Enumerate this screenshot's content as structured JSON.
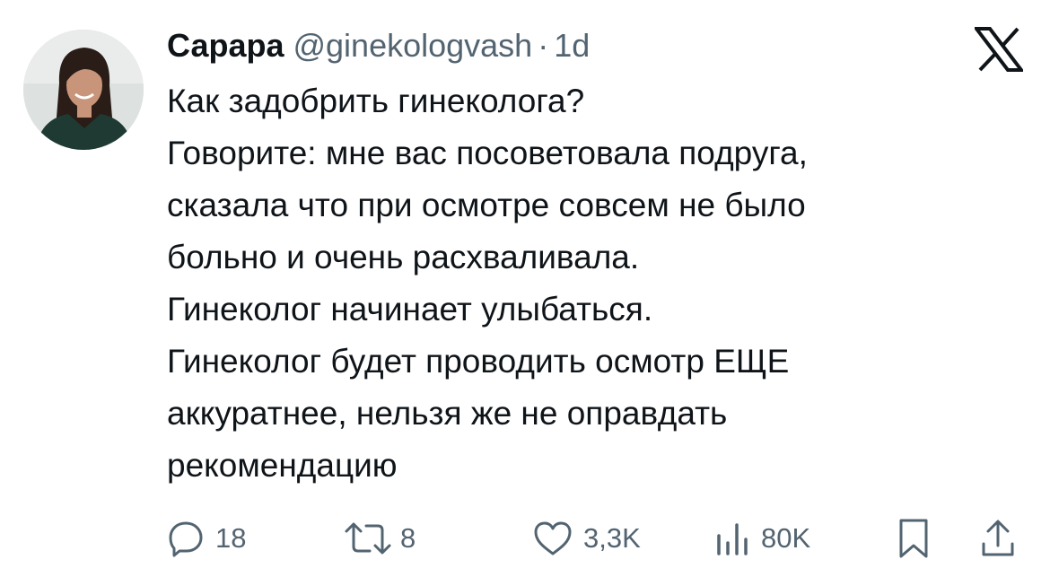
{
  "colors": {
    "text_primary": "#0f1419",
    "text_secondary": "#536471",
    "background": "#ffffff"
  },
  "author": {
    "display_name": "Сарара",
    "handle": "@ginekologvash",
    "separator": "·",
    "time": "1d",
    "avatar_icon": "profile-photo-woman"
  },
  "brand_icon": "x-logo-icon",
  "tweet": {
    "lines": [
      "Как задобрить гинеколога?",
      "Говорите: мне вас посоветовала подруга,",
      "сказала что при осмотре совсем не было",
      "больно и очень расхваливала.",
      "Гинеколог начинает улыбаться.",
      "Гинеколог будет проводить осмотр ЕЩЕ",
      "аккуратнее, нельзя же не оправдать",
      "рекомендацию"
    ]
  },
  "actions": {
    "reply": {
      "icon": "reply-icon",
      "count": "18"
    },
    "retweet": {
      "icon": "retweet-icon",
      "count": "8"
    },
    "like": {
      "icon": "heart-icon",
      "count": "3,3K"
    },
    "views": {
      "icon": "views-chart-icon",
      "count": "80K"
    },
    "bookmark": {
      "icon": "bookmark-icon"
    },
    "share": {
      "icon": "share-icon"
    }
  }
}
